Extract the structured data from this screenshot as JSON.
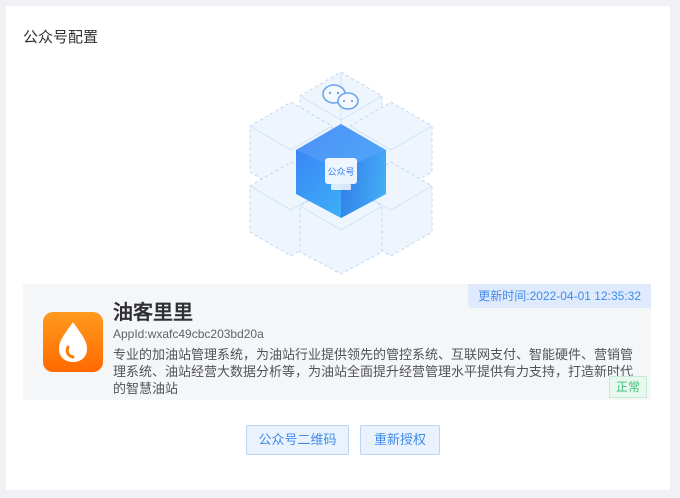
{
  "page": {
    "title": "公众号配置"
  },
  "hero": {
    "center_label": "公众号"
  },
  "app": {
    "update_time": "更新时间:2022-04-01 12:35:32",
    "name": "油客里里",
    "app_id": "AppId:wxafc49cbc203bd20a",
    "description": "专业的加油站管理系统，为油站行业提供领先的管控系统、互联网支付、智能硬件、营销管理系统、油站经营大数据分析等，为油站全面提升经营管理水平提供有力支持，打造新时代的智慧油站",
    "status": "正常"
  },
  "actions": {
    "qr_code_label": "公众号二维码",
    "reauthorize_label": "重新授权"
  },
  "colors": {
    "accent": "#3f8be8",
    "status_ok": "#3fbf7a",
    "logo_orange": "#ff7a00"
  },
  "icons": {
    "hero_top": "wechat-icon",
    "app_logo": "drop-icon"
  }
}
